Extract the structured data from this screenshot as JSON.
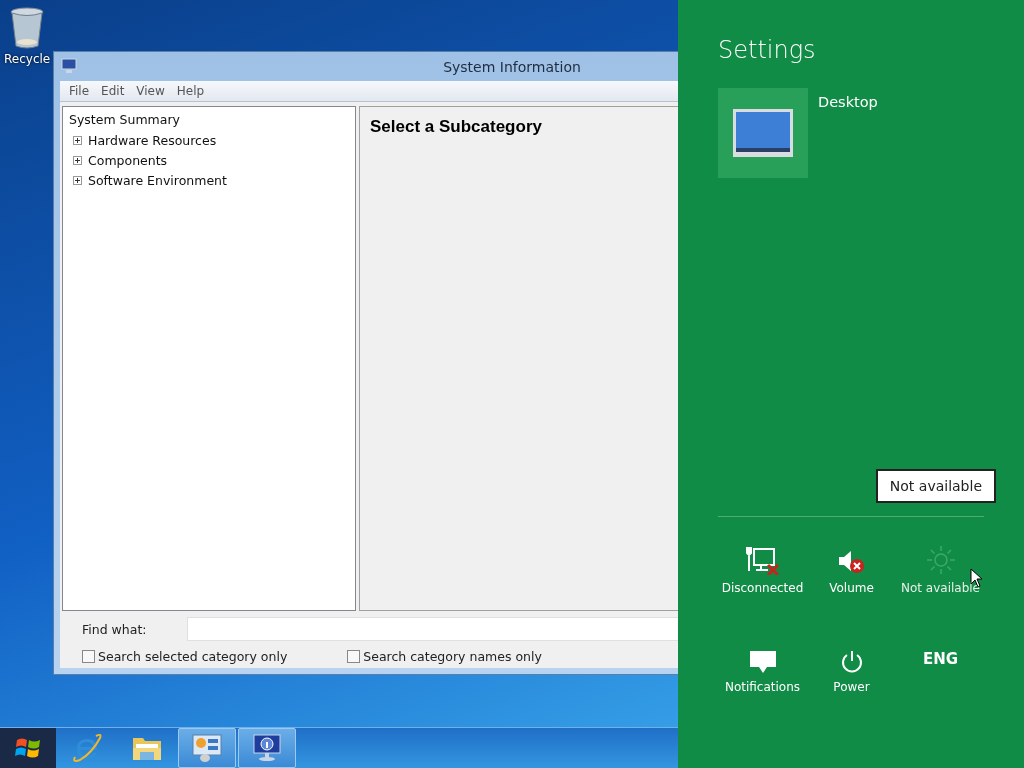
{
  "desktop": {
    "icons": [
      {
        "label": "Recycle"
      }
    ]
  },
  "window": {
    "title": "System Information",
    "menu": [
      "File",
      "Edit",
      "View",
      "Help"
    ],
    "tree": [
      {
        "label": "System Summary",
        "children": [
          {
            "label": "Hardware Resources",
            "expanded": false
          },
          {
            "label": "Components",
            "expanded": false
          },
          {
            "label": "Software Environment",
            "expanded": false
          }
        ]
      }
    ],
    "detail_heading": "Select a Subcategory",
    "find": {
      "label": "Find what:"
    },
    "options": [
      {
        "label": "Search selected category only",
        "checked": false
      },
      {
        "label": "Search category names only",
        "checked": false
      }
    ]
  },
  "taskbar": {
    "items": [
      {
        "kind": "start",
        "running": false
      },
      {
        "kind": "browser",
        "running": false
      },
      {
        "kind": "folder",
        "running": false
      },
      {
        "kind": "control-panel",
        "running": true
      },
      {
        "kind": "system-info",
        "running": true
      }
    ]
  },
  "settings": {
    "title": "Settings",
    "tiles": [
      {
        "label": "Desktop"
      }
    ],
    "tooltip": "Not available",
    "quick": [
      {
        "kind": "network",
        "label": "Disconnected",
        "disabled": false
      },
      {
        "kind": "volume",
        "label": "Volume",
        "disabled": false
      },
      {
        "kind": "brightness",
        "label": "Not available",
        "disabled": true
      },
      {
        "kind": "notifications",
        "label": "Notifications",
        "disabled": false
      },
      {
        "kind": "power",
        "label": "Power",
        "disabled": false
      },
      {
        "kind": "language",
        "glyph": "ENG"
      }
    ]
  }
}
